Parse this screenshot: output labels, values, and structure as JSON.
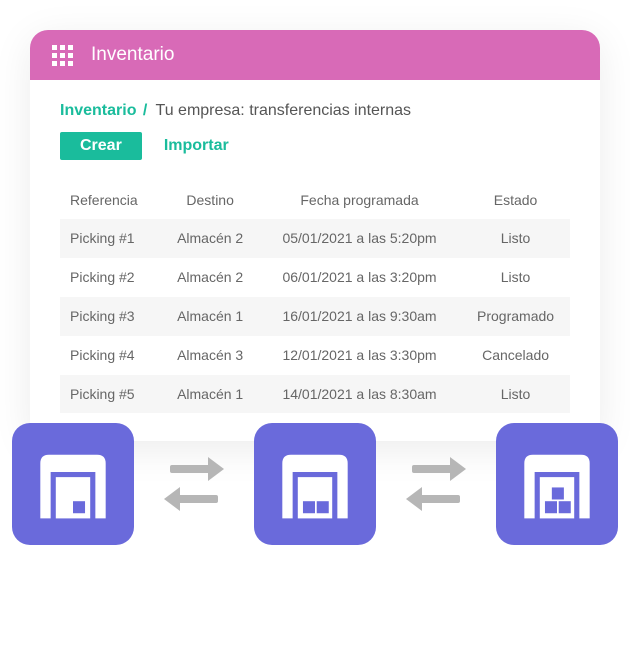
{
  "header": {
    "title": "Inventario"
  },
  "breadcrumb": {
    "module": "Inventario",
    "separator": "/",
    "page": "Tu empresa: transferencias internas"
  },
  "actions": {
    "create": "Crear",
    "import": "Importar"
  },
  "table": {
    "headers": {
      "ref": "Referencia",
      "dest": "Destino",
      "date": "Fecha programada",
      "status": "Estado"
    },
    "rows": [
      {
        "ref": "Picking #1",
        "dest": "Almacén 2",
        "date": "05/01/2021 a las 5:20pm",
        "status": "Listo"
      },
      {
        "ref": "Picking #2",
        "dest": "Almacén 2",
        "date": "06/01/2021 a las 3:20pm",
        "status": "Listo"
      },
      {
        "ref": "Picking #3",
        "dest": "Almacén 1",
        "date": "16/01/2021 a las 9:30am",
        "status": "Programado"
      },
      {
        "ref": "Picking #4",
        "dest": "Almacén 3",
        "date": "12/01/2021 a las 3:30pm",
        "status": "Cancelado"
      },
      {
        "ref": "Picking #5",
        "dest": "Almacén 1",
        "date": "14/01/2021 a las 8:30am",
        "status": "Listo"
      }
    ]
  },
  "colors": {
    "accent": "#1abc9c",
    "header": "#d86ab7",
    "tile": "#6a6adb"
  }
}
